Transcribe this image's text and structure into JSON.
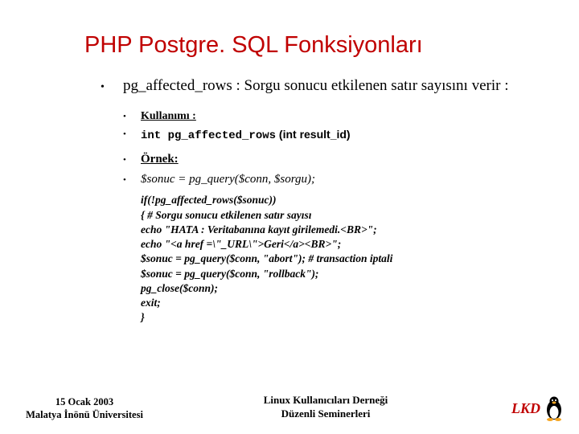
{
  "title": "PHP Postgre. SQL Fonksiyonları",
  "main": {
    "desc_prefix": "pg_affected_rows :  Sorgu sonucu etkilenen satır sayısını verir :",
    "usage_label": "Kullanımı :",
    "usage_sig_mono": "int pg_affected_rows",
    "usage_sig_rest": " (int result_id)",
    "example_label": "Örnek:",
    "example_call": "$sonuc = pg_query($conn, $sorgu);"
  },
  "code": [
    "if(!pg_affected_rows($sonuc))",
    "{ # Sorgu sonucu etkilenen satır sayısı",
    "echo \"HATA : Veritabanına kayıt girilemedi.<BR>\";",
    "echo \"<a href =\\\"_URL\\\">Geri</a><BR>\";",
    "$sonuc = pg_query($conn, \"abort\"); # transaction iptali",
    "$sonuc = pg_query($conn, \"rollback\");",
    "pg_close($conn);",
    "exit;",
    "}"
  ],
  "footer": {
    "left_line1": "15 Ocak 2003",
    "left_line2": "Malatya İnönü Üniversitesi",
    "center_line1": "Linux Kullanıcıları Derneği",
    "center_line2": "Düzenli Seminerleri",
    "logo_text": "LKD"
  }
}
